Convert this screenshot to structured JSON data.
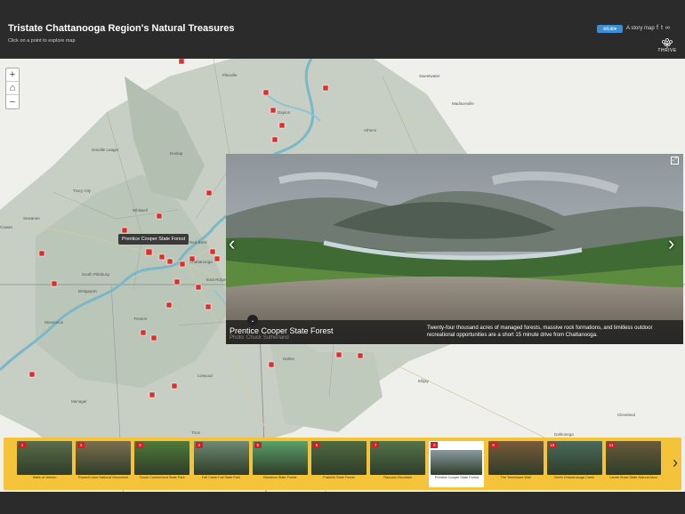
{
  "header": {
    "title": "Tristate Chattanooga Region's Natural Treasures",
    "subtitle": "Click on a point to explore map",
    "edit_label": "Edit",
    "storymap_label": "A story map",
    "logo_text": "THRIVE"
  },
  "map": {
    "zoom_in": "+",
    "zoom_out": "−",
    "tooltip": "Prentice Cooper State Forest",
    "labels": [
      "Pikeville",
      "Sweetwater",
      "Madisonville",
      "Dayton",
      "Athens",
      "Graville Laager",
      "Dunlap",
      "Tracy City",
      "Cowan",
      "Sewanee",
      "Whitwell",
      "Red Bank",
      "Chattanooga",
      "East Ridge",
      "South Pittsburg",
      "Bridgeport",
      "Stevenson",
      "Trenton",
      "Dalton",
      "Ellijay",
      "Linwood",
      "Menager",
      "Trion",
      "Cleveland",
      "Dahlonega"
    ]
  },
  "popup": {
    "title": "Prentice Cooper State Forest",
    "credit": "Photo: Chuck Sutherland",
    "description": "Twenty-four thousand acres of managed forests, massive rock formations, and limitless outdoor recreational opportunities are a short 15 minute drive from Chattanooga.",
    "prev": "‹",
    "next": "›"
  },
  "carousel": {
    "items": [
      {
        "num": "1",
        "label": "Walls of Jericho",
        "color": "#5b6d4a"
      },
      {
        "num": "2",
        "label": "Russell Cave National Monument",
        "color": "#7d6e4f"
      },
      {
        "num": "3",
        "label": "South Cumberland State Park",
        "color": "#4f7a3a"
      },
      {
        "num": "4",
        "label": "Fall Creek Fall State Park",
        "color": "#6f8a72"
      },
      {
        "num": "5",
        "label": "Blackbox State Forest",
        "color": "#5aa06a"
      },
      {
        "num": "6",
        "label": "Franklin State Forest",
        "color": "#4f6a40"
      },
      {
        "num": "7",
        "label": "Raccoon Mountain",
        "color": "#55734a"
      },
      {
        "num": "8",
        "label": "Prentice Cooper State Forest",
        "color": "#8a9aa0"
      },
      {
        "num": "9",
        "label": "The Tennessee Wall",
        "color": "#7a5a3a"
      },
      {
        "num": "10",
        "label": "North Chickamauga Creek",
        "color": "#4a6a5a"
      },
      {
        "num": "11",
        "label": "Laurel Snow State Natural Area",
        "color": "#6a5a3a"
      }
    ],
    "next": "›",
    "active_index": 7
  }
}
